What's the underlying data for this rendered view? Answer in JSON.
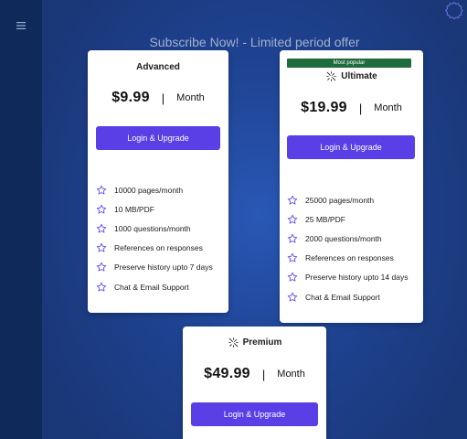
{
  "colors": {
    "accent": "#5a3ee6",
    "badge": "#1e6b3c",
    "sidebar": "#10295b",
    "background": "#1f4494"
  },
  "headline": "Subscribe Now! - Limited period offer",
  "plans": [
    {
      "name": "Advanced",
      "price": "$9.99",
      "separator": "|",
      "period": "Month",
      "cta": "Login & Upgrade",
      "features": [
        "10000 pages/month",
        "10 MB/PDF",
        "1000 questions/month",
        "References on responses",
        "Preserve history upto 7 days",
        "Chat & Email Support"
      ]
    },
    {
      "name": "Ultimate",
      "badge": "Most popular",
      "icon": "sparkle-icon",
      "price": "$19.99",
      "separator": "|",
      "period": "Month",
      "cta": "Login & Upgrade",
      "features": [
        "25000 pages/month",
        "25 MB/PDF",
        "2000 questions/month",
        "References on responses",
        "Preserve history upto 14 days",
        "Chat & Email Support"
      ]
    },
    {
      "name": "Premium",
      "icon": "sparkle-icon",
      "price": "$49.99",
      "separator": "|",
      "period": "Month",
      "cta": "Login & Upgrade"
    }
  ]
}
